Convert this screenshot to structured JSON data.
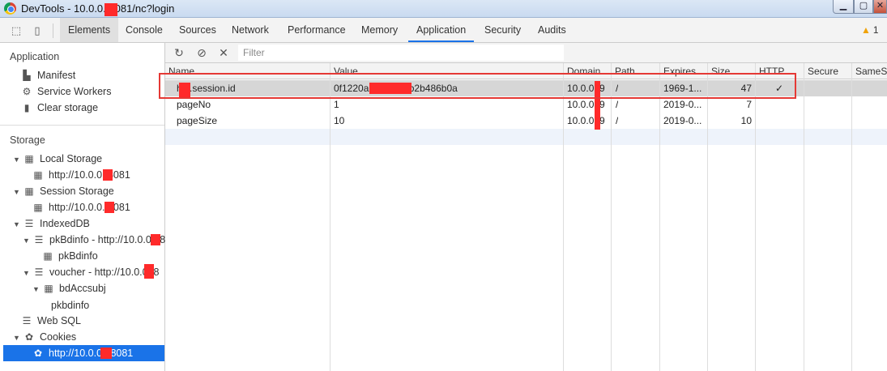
{
  "window": {
    "title": "DevTools - 10.0.0.  8081/nc?login"
  },
  "tabs": [
    "Elements",
    "Console",
    "Sources",
    "Network",
    "Performance",
    "Memory",
    "Application",
    "Security",
    "Audits"
  ],
  "warnings": {
    "count": "1",
    "icon": "warning-triangle-icon"
  },
  "sidebar": {
    "application_header": "Application",
    "application_items": [
      "Manifest",
      "Service Workers",
      "Clear storage"
    ],
    "storage_header": "Storage",
    "storage": {
      "local_storage": "Local Storage",
      "local_storage_origin": "http://10.0.0.  8081",
      "session_storage": "Session Storage",
      "session_storage_origin": "http://10.0.0.  8081",
      "indexeddb": "IndexedDB",
      "db1": "pkBdinfo - http://10.0.0.  :8",
      "db1_store": "pkBdinfo",
      "db2": "voucher - http://10.0.0  :8",
      "db2_store": "bdAccsubj",
      "db2_index": "pkbdinfo",
      "websql": "Web SQL",
      "cookies": "Cookies",
      "cookies_origin": "http://10.0.0.  :8081"
    }
  },
  "toolbar": {
    "filter_placeholder": "Filter"
  },
  "table": {
    "columns": [
      "Name",
      "Value",
      "Domain",
      "Path",
      "Expires ...",
      "Size",
      "HTTP",
      "Secure",
      "SameSi"
    ],
    "rows": [
      {
        "name": "h  c.session.id",
        "value": "0f1220a            b0c31b5b2b486b0a",
        "domain": "10.0.0.  9",
        "path": "/",
        "expires": "1969-1...",
        "size": "47",
        "http": "✓"
      },
      {
        "name": "pageNo",
        "value": "1",
        "domain": "10.0.0.  9",
        "path": "/",
        "expires": "2019-0...",
        "size": "7",
        "http": ""
      },
      {
        "name": "pageSize",
        "value": "10",
        "domain": "10.0.0.  9",
        "path": "/",
        "expires": "2019-0...",
        "size": "10",
        "http": ""
      }
    ]
  },
  "colors": {
    "accent": "#1a73e8",
    "highlight": "#e53935",
    "redaction": "#ff2a2a"
  }
}
